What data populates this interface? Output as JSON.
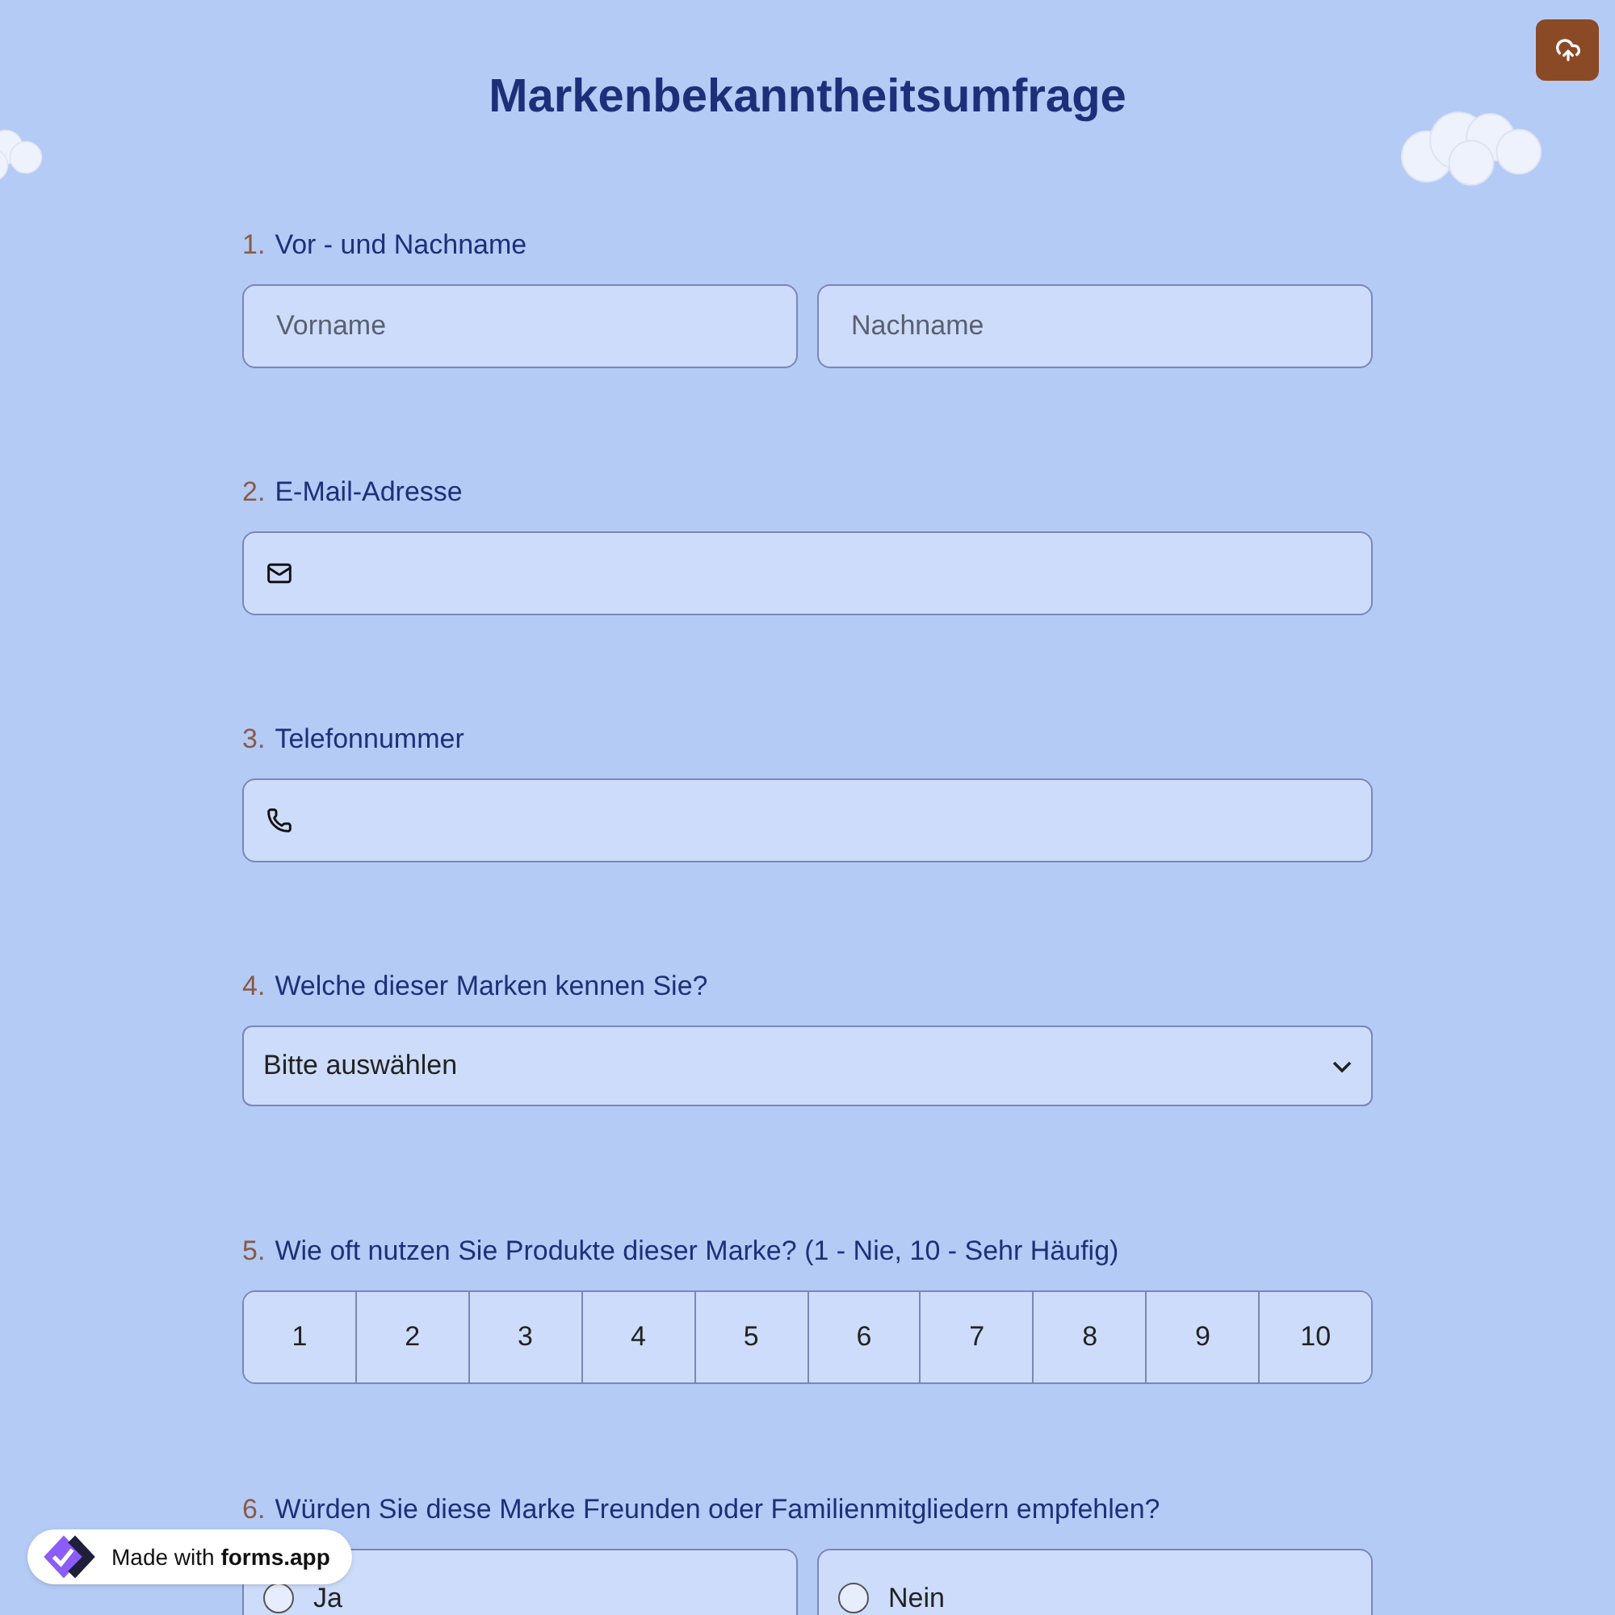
{
  "title": "Markenbekanntheitsumfrage",
  "questions": [
    {
      "kind": "name",
      "number": "1.",
      "label": "Vor - und Nachname",
      "placeholders": [
        "Vorname",
        "Nachname"
      ]
    },
    {
      "kind": "email",
      "number": "2.",
      "label": "E-Mail-Adresse"
    },
    {
      "kind": "phone",
      "number": "3.",
      "label": "Telefonnummer"
    },
    {
      "kind": "dropdown",
      "number": "4.",
      "label": "Welche dieser Marken kennen Sie?",
      "value": "Bitte auswählen"
    },
    {
      "kind": "scale",
      "number": "5.",
      "label": "Wie oft nutzen Sie Produkte dieser Marke? (1 - Nie, 10 - Sehr Häufig)",
      "options": [
        {
          "label": "1",
          "selected": false
        },
        {
          "label": "2",
          "selected": false
        },
        {
          "label": "3",
          "selected": false
        },
        {
          "label": "4",
          "selected": false
        },
        {
          "label": "5",
          "selected": false
        },
        {
          "label": "6",
          "selected": false
        },
        {
          "label": "7",
          "selected": false
        },
        {
          "label": "8",
          "selected": false
        },
        {
          "label": "9",
          "selected": false
        },
        {
          "label": "10",
          "selected": false
        }
      ]
    },
    {
      "kind": "radio",
      "number": "6.",
      "label": "Würden Sie diese Marke Freunden oder Familienmitgliedern empfehlen?",
      "options": [
        {
          "label": "Ja",
          "selected": false
        },
        {
          "label": "Nein",
          "selected": false
        }
      ]
    }
  ],
  "badge": "Made with **forms.app**"
}
